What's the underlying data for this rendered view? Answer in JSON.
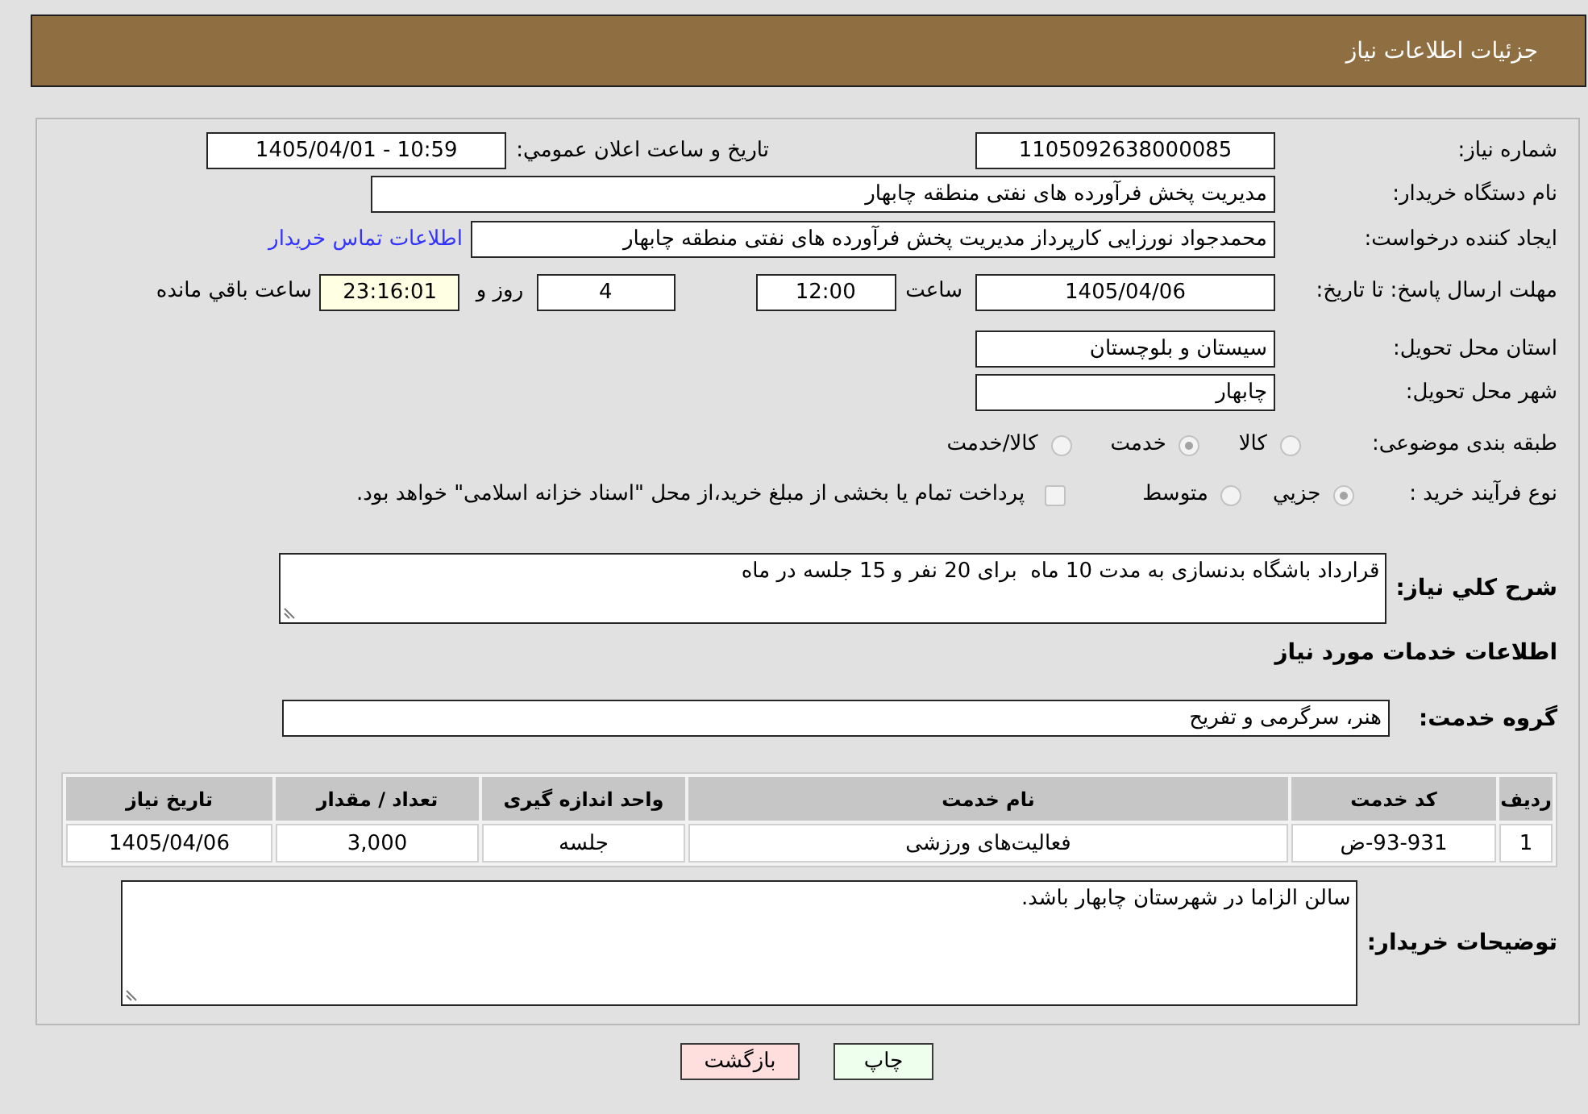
{
  "header": {
    "title": "جزئیات اطلاعات نیاز"
  },
  "need_number": {
    "label": "شماره نیاز:",
    "value": "1105092638000085"
  },
  "announcement": {
    "label": "تاريخ و ساعت اعلان عمومي:",
    "value": "1405/04/01 - 10:59"
  },
  "buyer_organization": {
    "label": "نام دستگاه خریدار:",
    "value": "مدیریت پخش فرآورده های نفتی منطقه چابهار"
  },
  "requester": {
    "label": "ایجاد کننده درخواست:",
    "value": "محمدجواد نورزایی کارپرداز مدیریت پخش فرآورده های نفتی منطقه چابهار",
    "contact_link": "اطلاعات تماس خریدار"
  },
  "deadline": {
    "label": "مهلت ارسال پاسخ: تا تاریخ:",
    "date": "1405/04/06",
    "time_label": "ساعت",
    "time": "12:00",
    "days": "4",
    "days_label": "روز و",
    "remaining_time": "23:16:01",
    "remaining_label": "ساعت باقي مانده"
  },
  "delivery_province": {
    "label": "استان محل تحویل:",
    "value": "سیستان و بلوچستان"
  },
  "delivery_city": {
    "label": "شهر محل تحویل:",
    "value": "چابهار"
  },
  "classification": {
    "label": "طبقه بندی موضوعی:",
    "options": [
      {
        "label": "کالا",
        "selected": false
      },
      {
        "label": "خدمت",
        "selected": true
      },
      {
        "label": "کالا/خدمت",
        "selected": false
      }
    ]
  },
  "purchase_type": {
    "label": "نوع فرآیند خرید :",
    "options": [
      {
        "label": "جزيي",
        "selected": true
      },
      {
        "label": "متوسط",
        "selected": false
      }
    ],
    "treasury_payment": {
      "label": "پرداخت تمام یا بخشی از مبلغ خرید،از محل \"اسناد خزانه اسلامی\" خواهد بود.",
      "checked": false
    }
  },
  "description": {
    "label": "شرح کلي نیاز:",
    "value": "قرارداد باشگاه بدنسازی به مدت 10 ماه  برای 20 نفر و 15 جلسه در ماه"
  },
  "services_section": {
    "title": "اطلاعات خدمات مورد نیاز",
    "service_group": {
      "label": "گروه خدمت:",
      "value": "هنر، سرگرمی و تفریح"
    },
    "table": {
      "columns": [
        "ردیف",
        "کد خدمت",
        "نام خدمت",
        "واحد اندازه گیری",
        "تعداد / مقدار",
        "تاریخ نیاز"
      ],
      "rows": [
        [
          "1",
          "ض-93-931",
          "فعالیت‌های ورزشی",
          "جلسه",
          "3,000",
          "1405/04/06"
        ]
      ]
    }
  },
  "buyer_notes": {
    "label": "توضیحات خریدار:",
    "value": "سالن الزاما در شهرستان چابهار باشد."
  },
  "buttons": [
    {
      "label": "چاپ",
      "kind": "print"
    },
    {
      "label": "بازگشت",
      "kind": "back"
    }
  ]
}
